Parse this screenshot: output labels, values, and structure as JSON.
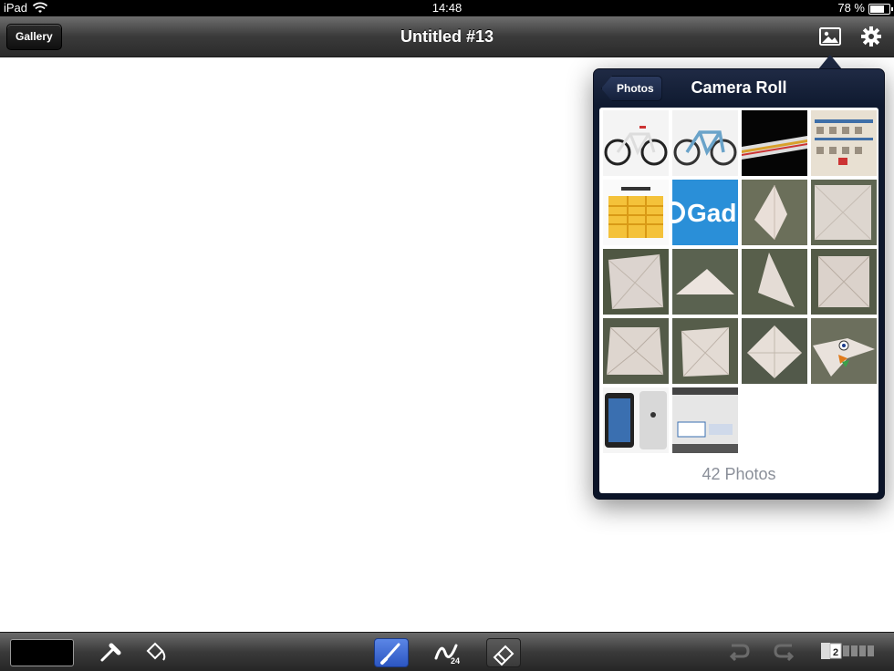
{
  "status_bar": {
    "carrier": "iPad",
    "time": "14:48",
    "battery": "78 %",
    "battery_level": 0.78
  },
  "toolbar": {
    "gallery_label": "Gallery",
    "title": "Untitled #13",
    "photo_icon": "photo-icon",
    "settings_icon": "gear-icon"
  },
  "popover": {
    "back_label": "Photos",
    "title": "Camera Roll",
    "photo_count": "42 Photos",
    "thumbnails": [
      "bike-white",
      "bike-blue",
      "train",
      "calendar",
      "chart-yellow",
      "gadget-logo",
      "paper-1",
      "paper-2",
      "paper-3",
      "paper-4",
      "paper-5",
      "paper-6",
      "paper-7",
      "paper-8",
      "paper-9",
      "paper-face",
      "ipad-photo",
      "screenshot"
    ]
  },
  "bottom_toolbar": {
    "color": "#000000",
    "tools": [
      "eyedropper-icon",
      "fill-bucket-icon",
      "brush-icon",
      "brush-style-icon",
      "eraser-icon",
      "undo-icon",
      "redo-icon"
    ],
    "brush_size": "24",
    "layer_number": "2"
  }
}
